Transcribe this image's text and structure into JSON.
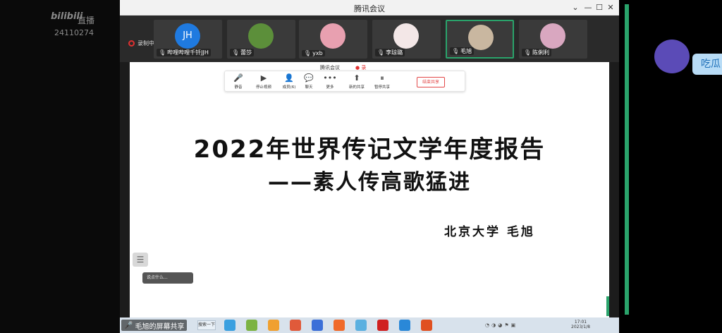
{
  "bilibili": {
    "logo": "bilibili",
    "live": "直播",
    "room_id": "24110274"
  },
  "window": {
    "title": "腾讯会议",
    "controls": [
      "⌄",
      "—",
      "☐",
      "✕"
    ]
  },
  "recording": {
    "label": "录制中"
  },
  "participants": [
    {
      "name": "哔哩哔哩千钎JJH",
      "avatar_text": "JH",
      "avatar_color": "#1f7ae0",
      "active": false
    },
    {
      "name": "蕾莎",
      "avatar_text": "",
      "avatar_color": "#5c8f3a",
      "active": false
    },
    {
      "name": "yxb",
      "avatar_text": "",
      "avatar_color": "#e8a0b0",
      "active": false
    },
    {
      "name": "李琼璐",
      "avatar_text": "",
      "avatar_color": "#f3e7e7",
      "active": false
    },
    {
      "name": "毛旭",
      "avatar_text": "",
      "avatar_color": "#c9b7a0",
      "active": true
    },
    {
      "name": "陈俐利",
      "avatar_text": "",
      "avatar_color": "#d9a7c0",
      "active": false
    }
  ],
  "share_toolbar": {
    "title": "腾讯会议",
    "rec": "● 录",
    "items": [
      {
        "label": "静音",
        "icon": "mic-icon",
        "glyph": "🎤"
      },
      {
        "label": "停止视频",
        "icon": "camera-icon",
        "glyph": "▶"
      },
      {
        "label": "成员(6)",
        "icon": "members-icon",
        "glyph": "👤"
      },
      {
        "label": "聊天",
        "icon": "chat-icon",
        "glyph": "💬"
      },
      {
        "label": "更多",
        "icon": "more-icon",
        "glyph": "•••"
      },
      {
        "label": "新的共享",
        "icon": "new-share-icon",
        "glyph": "⬆"
      },
      {
        "label": "暂停共享",
        "icon": "pause-share-icon",
        "glyph": "⏸"
      }
    ],
    "end_share": "结束共享"
  },
  "slide": {
    "title": "2022年世界传记文学年度报告",
    "subtitle": "——素人传高歌猛进",
    "author": "北京大学  毛旭"
  },
  "chat_pill": "说点什么...",
  "taskbar": {
    "sharing": "毛旭的屏幕共享",
    "search": "搜索一下",
    "clock_time": "17:01",
    "clock_date": "2023/1/8",
    "apps": [
      "#3aa0e0",
      "#7cb342",
      "#f0a030",
      "#e05a3a",
      "#3b6fd8",
      "#f06a2a",
      "#5ab0e0",
      "#d02020",
      "#2a88d8",
      "#e05020"
    ]
  },
  "side_label": "吃瓜"
}
